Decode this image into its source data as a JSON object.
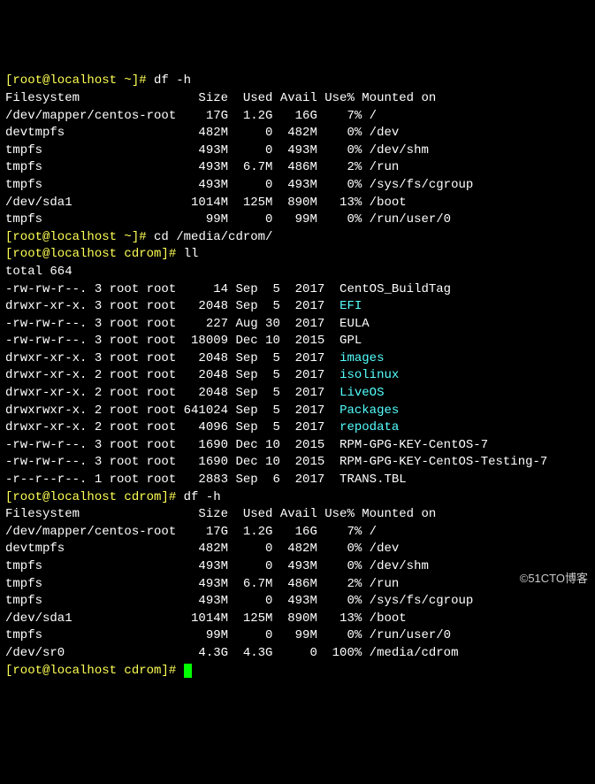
{
  "prompts": {
    "home": "[root@localhost ~]# ",
    "cdrom": "[root@localhost cdrom]# "
  },
  "cmds": {
    "df1": "df -h",
    "cd_cdrom": "cd /media/cdrom/",
    "ll": "ll",
    "df2": "df -h"
  },
  "df_header": {
    "fs": "Filesystem",
    "size": "Size",
    "used": "Used",
    "avail": "Avail",
    "usep": "Use%",
    "mount": "Mounted on"
  },
  "df1": [
    {
      "fs": "/dev/mapper/centos-root",
      "size": "17G",
      "used": "1.2G",
      "avail": "16G",
      "usep": "7%",
      "mount": "/"
    },
    {
      "fs": "devtmpfs",
      "size": "482M",
      "used": "0",
      "avail": "482M",
      "usep": "0%",
      "mount": "/dev"
    },
    {
      "fs": "tmpfs",
      "size": "493M",
      "used": "0",
      "avail": "493M",
      "usep": "0%",
      "mount": "/dev/shm"
    },
    {
      "fs": "tmpfs",
      "size": "493M",
      "used": "6.7M",
      "avail": "486M",
      "usep": "2%",
      "mount": "/run"
    },
    {
      "fs": "tmpfs",
      "size": "493M",
      "used": "0",
      "avail": "493M",
      "usep": "0%",
      "mount": "/sys/fs/cgroup"
    },
    {
      "fs": "/dev/sda1",
      "size": "1014M",
      "used": "125M",
      "avail": "890M",
      "usep": "13%",
      "mount": "/boot"
    },
    {
      "fs": "tmpfs",
      "size": "99M",
      "used": "0",
      "avail": "99M",
      "usep": "0%",
      "mount": "/run/user/0"
    }
  ],
  "ll_total": "total 664",
  "ll": [
    {
      "perm": "-rw-rw-r--.",
      "links": "3",
      "owner": "root",
      "group": "root",
      "size": "14",
      "month": "Sep",
      "day": "5",
      "year": "2017",
      "name": "CentOS_BuildTag",
      "dir": false
    },
    {
      "perm": "drwxr-xr-x.",
      "links": "3",
      "owner": "root",
      "group": "root",
      "size": "2048",
      "month": "Sep",
      "day": "5",
      "year": "2017",
      "name": "EFI",
      "dir": true
    },
    {
      "perm": "-rw-rw-r--.",
      "links": "3",
      "owner": "root",
      "group": "root",
      "size": "227",
      "month": "Aug",
      "day": "30",
      "year": "2017",
      "name": "EULA",
      "dir": false
    },
    {
      "perm": "-rw-rw-r--.",
      "links": "3",
      "owner": "root",
      "group": "root",
      "size": "18009",
      "month": "Dec",
      "day": "10",
      "year": "2015",
      "name": "GPL",
      "dir": false
    },
    {
      "perm": "drwxr-xr-x.",
      "links": "3",
      "owner": "root",
      "group": "root",
      "size": "2048",
      "month": "Sep",
      "day": "5",
      "year": "2017",
      "name": "images",
      "dir": true
    },
    {
      "perm": "drwxr-xr-x.",
      "links": "2",
      "owner": "root",
      "group": "root",
      "size": "2048",
      "month": "Sep",
      "day": "5",
      "year": "2017",
      "name": "isolinux",
      "dir": true
    },
    {
      "perm": "drwxr-xr-x.",
      "links": "2",
      "owner": "root",
      "group": "root",
      "size": "2048",
      "month": "Sep",
      "day": "5",
      "year": "2017",
      "name": "LiveOS",
      "dir": true
    },
    {
      "perm": "drwxrwxr-x.",
      "links": "2",
      "owner": "root",
      "group": "root",
      "size": "641024",
      "month": "Sep",
      "day": "5",
      "year": "2017",
      "name": "Packages",
      "dir": true
    },
    {
      "perm": "drwxr-xr-x.",
      "links": "2",
      "owner": "root",
      "group": "root",
      "size": "4096",
      "month": "Sep",
      "day": "5",
      "year": "2017",
      "name": "repodata",
      "dir": true
    },
    {
      "perm": "-rw-rw-r--.",
      "links": "3",
      "owner": "root",
      "group": "root",
      "size": "1690",
      "month": "Dec",
      "day": "10",
      "year": "2015",
      "name": "RPM-GPG-KEY-CentOS-7",
      "dir": false
    },
    {
      "perm": "-rw-rw-r--.",
      "links": "3",
      "owner": "root",
      "group": "root",
      "size": "1690",
      "month": "Dec",
      "day": "10",
      "year": "2015",
      "name": "RPM-GPG-KEY-CentOS-Testing-7",
      "dir": false
    },
    {
      "perm": "-r--r--r--.",
      "links": "1",
      "owner": "root",
      "group": "root",
      "size": "2883",
      "month": "Sep",
      "day": "6",
      "year": "2017",
      "name": "TRANS.TBL",
      "dir": false
    }
  ],
  "df2": [
    {
      "fs": "/dev/mapper/centos-root",
      "size": "17G",
      "used": "1.2G",
      "avail": "16G",
      "usep": "7%",
      "mount": "/"
    },
    {
      "fs": "devtmpfs",
      "size": "482M",
      "used": "0",
      "avail": "482M",
      "usep": "0%",
      "mount": "/dev"
    },
    {
      "fs": "tmpfs",
      "size": "493M",
      "used": "0",
      "avail": "493M",
      "usep": "0%",
      "mount": "/dev/shm"
    },
    {
      "fs": "tmpfs",
      "size": "493M",
      "used": "6.7M",
      "avail": "486M",
      "usep": "2%",
      "mount": "/run"
    },
    {
      "fs": "tmpfs",
      "size": "493M",
      "used": "0",
      "avail": "493M",
      "usep": "0%",
      "mount": "/sys/fs/cgroup"
    },
    {
      "fs": "/dev/sda1",
      "size": "1014M",
      "used": "125M",
      "avail": "890M",
      "usep": "13%",
      "mount": "/boot"
    },
    {
      "fs": "tmpfs",
      "size": "99M",
      "used": "0",
      "avail": "99M",
      "usep": "0%",
      "mount": "/run/user/0"
    },
    {
      "fs": "/dev/sr0",
      "size": "4.3G",
      "used": "4.3G",
      "avail": "0",
      "usep": "100%",
      "mount": "/media/cdrom"
    }
  ],
  "watermark": "©51CTO博客"
}
